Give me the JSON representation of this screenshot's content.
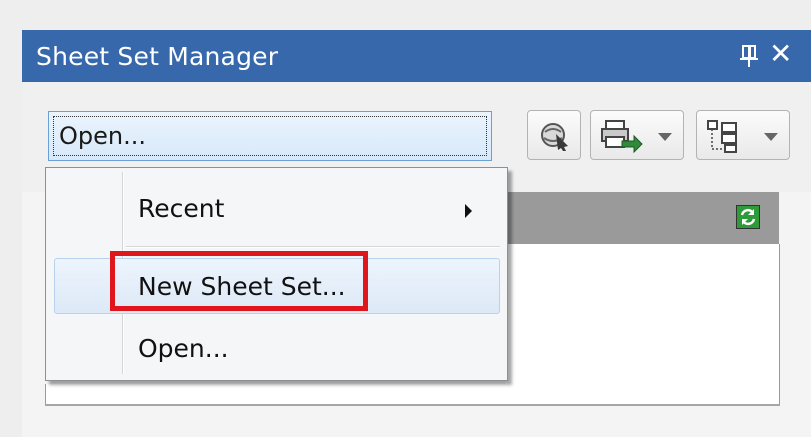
{
  "window": {
    "title": "Sheet Set Manager",
    "pin_icon": "pin-icon",
    "close_glyph": "✕"
  },
  "toolbar": {
    "combo_value": "Open...",
    "buttons": [
      {
        "icon": "sheet-set-details-icon"
      },
      {
        "icon": "publish-icon",
        "has_dropdown": true
      },
      {
        "icon": "model-views-icon",
        "has_dropdown": true
      }
    ]
  },
  "dropdown_menu": {
    "items": [
      {
        "label": "Recent",
        "has_submenu": true
      },
      {
        "label": "New Sheet Set...",
        "highlighted": true
      },
      {
        "label": "Open..."
      }
    ]
  },
  "list": {
    "refresh_icon": "refresh-icon"
  },
  "colors": {
    "title_bar": "#3768ac",
    "callout": "#e0161d",
    "highlight": "#dde9f7"
  }
}
